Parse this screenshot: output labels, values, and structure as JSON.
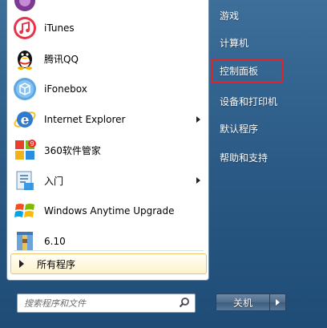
{
  "programs": [
    {
      "label": "iTunes",
      "icon": "itunes-icon",
      "has_arrow": false
    },
    {
      "label": "腾讯QQ",
      "icon": "qq-penguin-icon",
      "has_arrow": false
    },
    {
      "label": "iFonebox",
      "icon": "ifonebox-icon",
      "has_arrow": false
    },
    {
      "label": "Internet Explorer",
      "icon": "internet-explorer-icon",
      "has_arrow": true
    },
    {
      "label": "360软件管家",
      "icon": "360-software-manager-icon",
      "has_arrow": false
    },
    {
      "label": "入门",
      "icon": "getting-started-icon",
      "has_arrow": true
    },
    {
      "label": "Windows Anytime Upgrade",
      "icon": "windows-logo-icon",
      "has_arrow": false
    },
    {
      "label": "6.10",
      "icon": "winrar-archive-icon",
      "has_arrow": false
    }
  ],
  "all_programs_label": "所有程序",
  "search": {
    "placeholder": "搜索程序和文件"
  },
  "right_items": [
    {
      "label": "游戏"
    },
    {
      "label": "计算机"
    },
    {
      "label": "控制面板",
      "highlighted": true
    },
    {
      "label": "设备和打印机"
    },
    {
      "label": "默认程序"
    },
    {
      "label": "帮助和支持"
    }
  ],
  "shutdown_label": "关机",
  "colors": {
    "highlight_border": "#e0242a",
    "all_programs_bg": "#fff3cc"
  }
}
